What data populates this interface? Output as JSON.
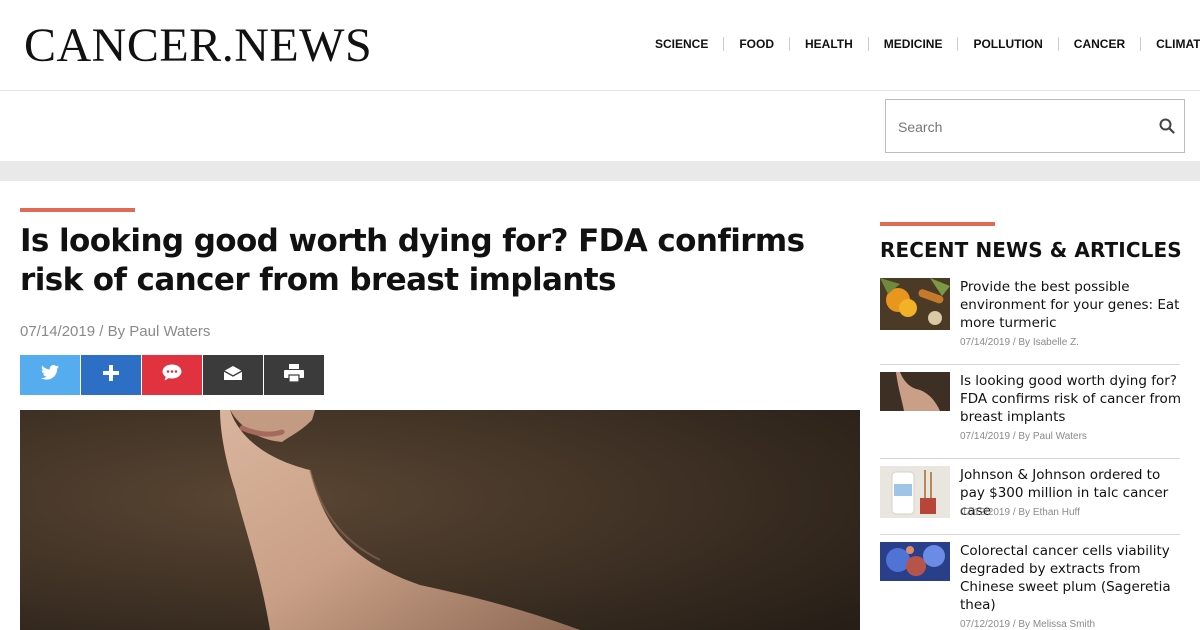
{
  "site": {
    "logo": "CANCER.NEWS"
  },
  "nav": [
    "SCIENCE",
    "FOOD",
    "HEALTH",
    "MEDICINE",
    "POLLUTION",
    "CANCER",
    "CLIMATE"
  ],
  "search": {
    "placeholder": "Search"
  },
  "article": {
    "title": "Is looking good worth dying for? FDA confirms risk of cancer from breast implants",
    "byline": "07/14/2019 / By Paul Waters",
    "share": [
      {
        "icon": "twitter-icon",
        "color": "#55acee"
      },
      {
        "icon": "plus-icon",
        "color": "#2d6fc4"
      },
      {
        "icon": "chat-icon",
        "color": "#e0333f"
      },
      {
        "icon": "mail-icon",
        "color": "#3b3b3b"
      },
      {
        "icon": "print-icon",
        "color": "#3b3b3b"
      }
    ]
  },
  "sidebar": {
    "heading": "RECENT NEWS & ARTICLES",
    "items": [
      {
        "title": "Provide the best possible environment for your genes: Eat more turmeric",
        "meta": "07/14/2019 / By Isabelle Z."
      },
      {
        "title": "Is looking good worth dying for? FDA confirms risk of cancer from breast implants",
        "meta": "07/14/2019 / By Paul Waters"
      },
      {
        "title": "Johnson & Johnson ordered to pay $300 million in talc cancer case",
        "meta": "07/12/2019 / By Ethan Huff"
      },
      {
        "title": "Colorectal cancer cells viability degraded by extracts from Chinese sweet plum (Sageretia thea)",
        "meta": "07/12/2019 / By Melissa Smith"
      }
    ]
  },
  "colors": {
    "accent": "#e06b55",
    "band": "#e9e9e9"
  }
}
